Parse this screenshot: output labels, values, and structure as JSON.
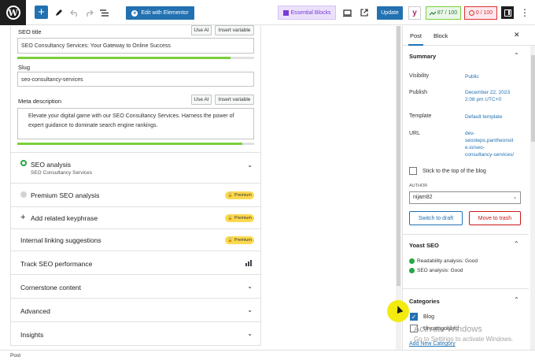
{
  "toolbar": {
    "wp_logo": "W",
    "add_icon": "+",
    "edit_elementor_label": "Edit with Elementor",
    "essential_blocks_label": "Essential Blocks",
    "update_label": "Update",
    "yoast_y": "y",
    "seo_score": "87 / 100",
    "readability_score": "0 / 100"
  },
  "seo_title": {
    "label": "SEO title",
    "use_ai": "Use AI",
    "insert_variable": "Insert variable",
    "value": "SEO Consultancy Services: Your Gateway to Online Success",
    "progress": 0.9
  },
  "slug": {
    "label": "Slug",
    "value": "seo-consultancy-services"
  },
  "meta_description": {
    "label": "Meta description",
    "use_ai": "Use AI",
    "insert_variable": "Insert variable",
    "value": "Elevate your digital game with our SEO Consultancy Services. Harness the power of expert guidance to dominate search engine rankings.",
    "progress": 0.95
  },
  "accordions": {
    "seo_analysis": {
      "title": "SEO analysis",
      "subtitle": "SEO Consultancy Services"
    },
    "premium_seo": {
      "title": "Premium SEO analysis",
      "badge": "Premium"
    },
    "related_keyphrase": {
      "title": "Add related keyphrase",
      "badge": "Premium"
    },
    "internal_linking": {
      "title": "Internal linking suggestions",
      "badge": "Premium"
    },
    "track_seo": {
      "title": "Track SEO performance"
    },
    "cornerstone": {
      "title": "Cornerstone content"
    },
    "advanced": {
      "title": "Advanced"
    },
    "insights": {
      "title": "Insights"
    }
  },
  "sidebar": {
    "tabs": [
      "Post",
      "Block"
    ],
    "summary": {
      "title": "Summary",
      "visibility_label": "Visibility",
      "visibility_value": "Public",
      "publish_label": "Publish",
      "publish_value_1": "December 22, 2023",
      "publish_value_2": "2:08 pm UTC+0",
      "template_label": "Template",
      "template_value": "Default template",
      "url_label": "URL",
      "url_value_1": "dev-",
      "url_value_2": "seosteps.pantheonsit",
      "url_value_3": "e.io/seo-",
      "url_value_4": "consultancy-services/",
      "sticky_label": "Stick to the top of the blog",
      "author_label": "AUTHOR",
      "author_value": "nijam82",
      "switch_draft": "Switch to draft",
      "move_trash": "Move to trash"
    },
    "yoast": {
      "title": "Yoast SEO",
      "readability": "Readability analysis: Good",
      "seo": "SEO analysis: Good"
    },
    "categories": {
      "title": "Categories",
      "items": [
        {
          "label": "Blog",
          "checked": true
        },
        {
          "label": "Uncategorized",
          "checked": false
        }
      ],
      "add_new": "Add New Category"
    }
  },
  "watermark": {
    "line1": "Activate Windows",
    "line2": "Go to Settings to activate Windows."
  },
  "statusbar": {
    "breadcrumb": "Post"
  }
}
